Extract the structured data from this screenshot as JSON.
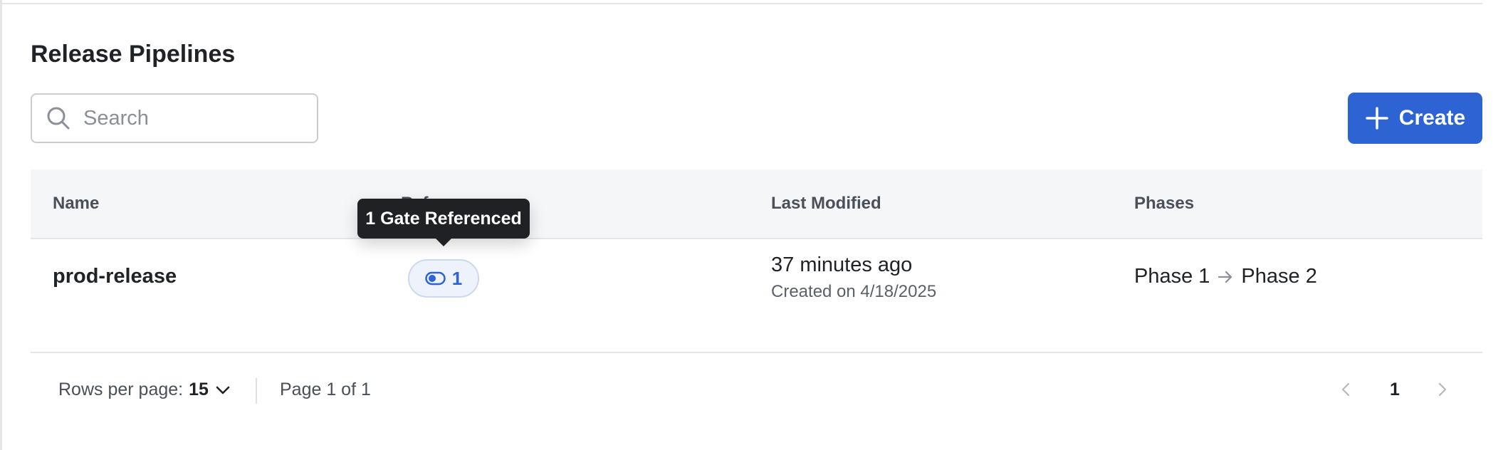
{
  "page": {
    "title": "Release Pipelines"
  },
  "search": {
    "placeholder": "Search",
    "icon": "search-icon"
  },
  "toolbar": {
    "create_label": "Create",
    "create_icon": "plus-icon",
    "accent_color": "#2e63d3"
  },
  "table": {
    "columns": [
      "Name",
      "References",
      "Last Modified",
      "Phases"
    ],
    "rows": [
      {
        "name": "prod-release",
        "references_count": "1",
        "references_icon": "toggle-icon",
        "last_modified": "37 minutes ago",
        "created": "Created on 4/18/2025",
        "phases": [
          "Phase 1",
          "Phase 2"
        ]
      }
    ]
  },
  "tooltip": {
    "text": "1 Gate Referenced"
  },
  "footer": {
    "rows_per_page_label": "Rows per page:",
    "rows_per_page_value": "15",
    "page_info": "Page 1 of 1",
    "current_page": "1"
  }
}
